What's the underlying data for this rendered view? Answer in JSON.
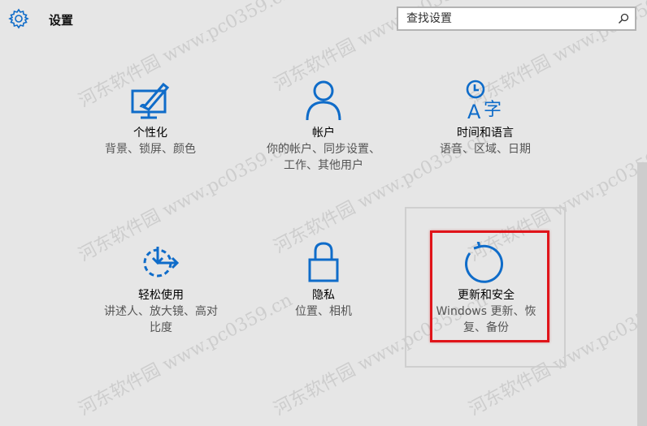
{
  "header": {
    "title": "设置",
    "icon": "gear-icon"
  },
  "search": {
    "placeholder": "查找设置",
    "icon": "search-icon"
  },
  "accent_color": "#0f6cc9",
  "highlight_color": "#e0141a",
  "tiles": [
    {
      "title": "个性化",
      "desc": [
        "背景、锁屏、颜色"
      ],
      "icon": "personalization-icon"
    },
    {
      "title": "帐户",
      "desc": [
        "你的帐户、同步设置、",
        "工作、其他用户"
      ],
      "icon": "accounts-icon"
    },
    {
      "title": "时间和语言",
      "desc": [
        "语音、区域、日期"
      ],
      "icon": "time-language-icon"
    },
    {
      "title": "轻松使用",
      "desc": [
        "讲述人、放大镜、高对",
        "比度"
      ],
      "icon": "ease-of-access-icon"
    },
    {
      "title": "隐私",
      "desc": [
        "位置、相机"
      ],
      "icon": "privacy-lock-icon"
    },
    {
      "title": "更新和安全",
      "desc": [
        "Windows 更新、恢",
        "复、备份"
      ],
      "icon": "update-security-icon"
    }
  ],
  "watermark": "河东软件园 www.pc0359.cn"
}
